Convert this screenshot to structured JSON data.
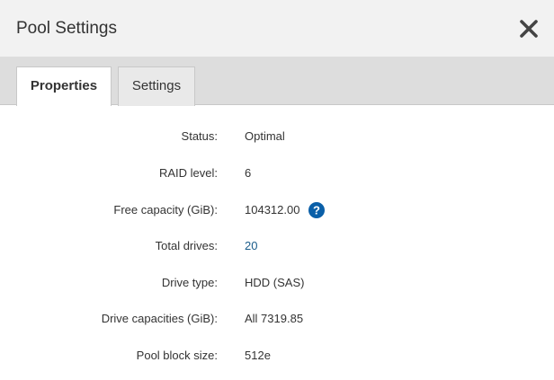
{
  "dialog": {
    "title": "Pool Settings",
    "close_icon": "close-icon"
  },
  "tabs": [
    {
      "label": "Properties",
      "active": true
    },
    {
      "label": "Settings",
      "active": false
    }
  ],
  "properties": [
    {
      "label": "Status:",
      "value": "Optimal"
    },
    {
      "label": "RAID level:",
      "value": "6"
    },
    {
      "label": "Free capacity (GiB):",
      "value": "104312.00",
      "icon": "help-icon"
    },
    {
      "label": "Total drives:",
      "value": "20",
      "link": true
    },
    {
      "label": "Drive type:",
      "value": "HDD (SAS)"
    },
    {
      "label": "Drive capacities (GiB):",
      "value": "All 7319.85"
    },
    {
      "label": "Pool block size:",
      "value": "512e"
    }
  ],
  "colors": {
    "header_bg": "#f2f2f2",
    "tabbar_bg": "#dddddd",
    "link": "#1a5c8a",
    "help_icon": "#0a5fa8"
  }
}
